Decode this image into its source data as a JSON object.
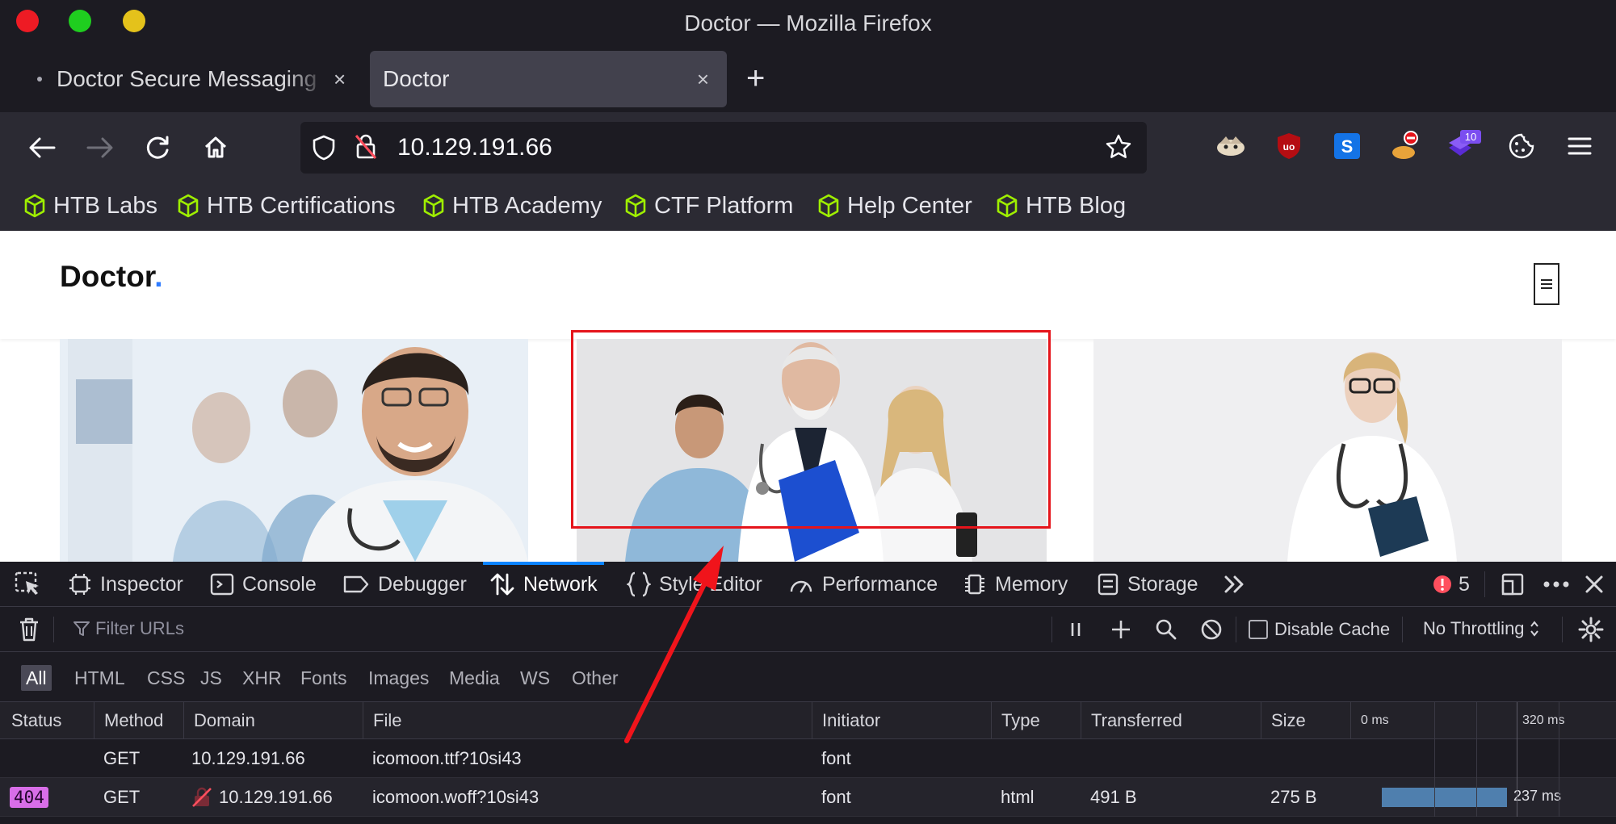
{
  "window": {
    "title": "Doctor — Mozilla Firefox"
  },
  "tabs": [
    {
      "label": "Doctor Secure Messaging"
    },
    {
      "label": "Doctor"
    }
  ],
  "tab_close": "×",
  "new_tab": "+",
  "address": {
    "url": "10.129.191.66"
  },
  "extensions": {
    "badge_count": "10"
  },
  "bookmarks": [
    {
      "label": "HTB Labs"
    },
    {
      "label": "HTB Certifications"
    },
    {
      "label": "HTB Academy"
    },
    {
      "label": "CTF Platform"
    },
    {
      "label": "Help Center"
    },
    {
      "label": "HTB Blog"
    }
  ],
  "page": {
    "logo": "Doctor",
    "logo_dot": "."
  },
  "devtools": {
    "tabs": [
      "Inspector",
      "Console",
      "Debugger",
      "Network",
      "Style Editor",
      "Performance",
      "Memory",
      "Storage"
    ],
    "error_count": "5",
    "filter_placeholder": "Filter URLs",
    "disable_cache": "Disable Cache",
    "throttling": "No Throttling",
    "type_filters": [
      "All",
      "HTML",
      "CSS",
      "JS",
      "XHR",
      "Fonts",
      "Images",
      "Media",
      "WS",
      "Other"
    ],
    "columns": [
      "Status",
      "Method",
      "Domain",
      "File",
      "Initiator",
      "Type",
      "Transferred",
      "Size"
    ],
    "waterfall_ticks": [
      "0 ms",
      "320 ms"
    ],
    "rows": [
      {
        "status": "",
        "method": "GET",
        "domain": "10.129.191.66",
        "file": "icomoon.ttf?10si43",
        "initiator": "font",
        "type": "",
        "transferred": "",
        "size": "",
        "time": ""
      },
      {
        "status": "404",
        "method": "GET",
        "domain": "10.129.191.66",
        "file": "icomoon.woff?10si43",
        "initiator": "font",
        "type": "html",
        "transferred": "491 B",
        "size": "275 B",
        "time": "237 ms"
      }
    ]
  },
  "colors": {
    "accent": "#0a84ff",
    "highlight_box": "#e5141b",
    "status_404": "#d86ee8",
    "htb_green": "#9fef00"
  }
}
